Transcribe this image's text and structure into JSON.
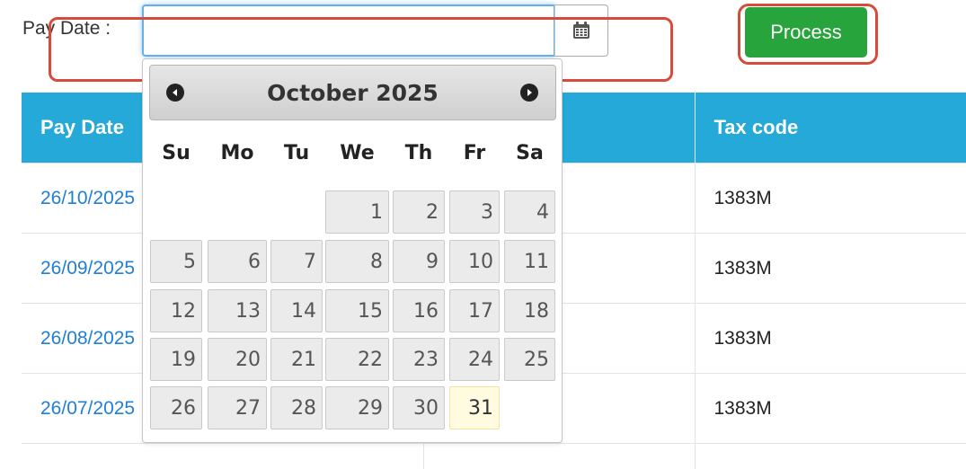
{
  "form": {
    "pay_date_label": "Pay Date :",
    "pay_date_value": "",
    "calendar_icon": "calendar-icon",
    "process_label": "Process"
  },
  "table": {
    "headers": [
      "Pay Date",
      "",
      "Tax code"
    ],
    "rows": [
      {
        "pay_date": "26/10/2025",
        "tax_code": "1383M"
      },
      {
        "pay_date": "26/09/2025",
        "tax_code": "1383M"
      },
      {
        "pay_date": "26/08/2025",
        "tax_code": "1383M"
      },
      {
        "pay_date": "26/07/2025",
        "tax_code": "1383M"
      }
    ]
  },
  "datepicker": {
    "title": "October 2025",
    "prev_icon": "circle-arrow-left-icon",
    "next_icon": "circle-arrow-right-icon",
    "weekdays": [
      "Su",
      "Mo",
      "Tu",
      "We",
      "Th",
      "Fr",
      "Sa"
    ],
    "weeks": [
      [
        "",
        "",
        "",
        "1",
        "2",
        "3",
        "4"
      ],
      [
        "5",
        "6",
        "7",
        "8",
        "9",
        "10",
        "11"
      ],
      [
        "12",
        "13",
        "14",
        "15",
        "16",
        "17",
        "18"
      ],
      [
        "19",
        "20",
        "21",
        "22",
        "23",
        "24",
        "25"
      ],
      [
        "26",
        "27",
        "28",
        "29",
        "30",
        "31",
        ""
      ]
    ],
    "today": "31"
  },
  "colors": {
    "header_bg": "#24a9d9",
    "process_bg": "#27a43c",
    "highlight": "#d64b3c",
    "link": "#1f7fd6",
    "today_bg": "#fffbe0"
  }
}
